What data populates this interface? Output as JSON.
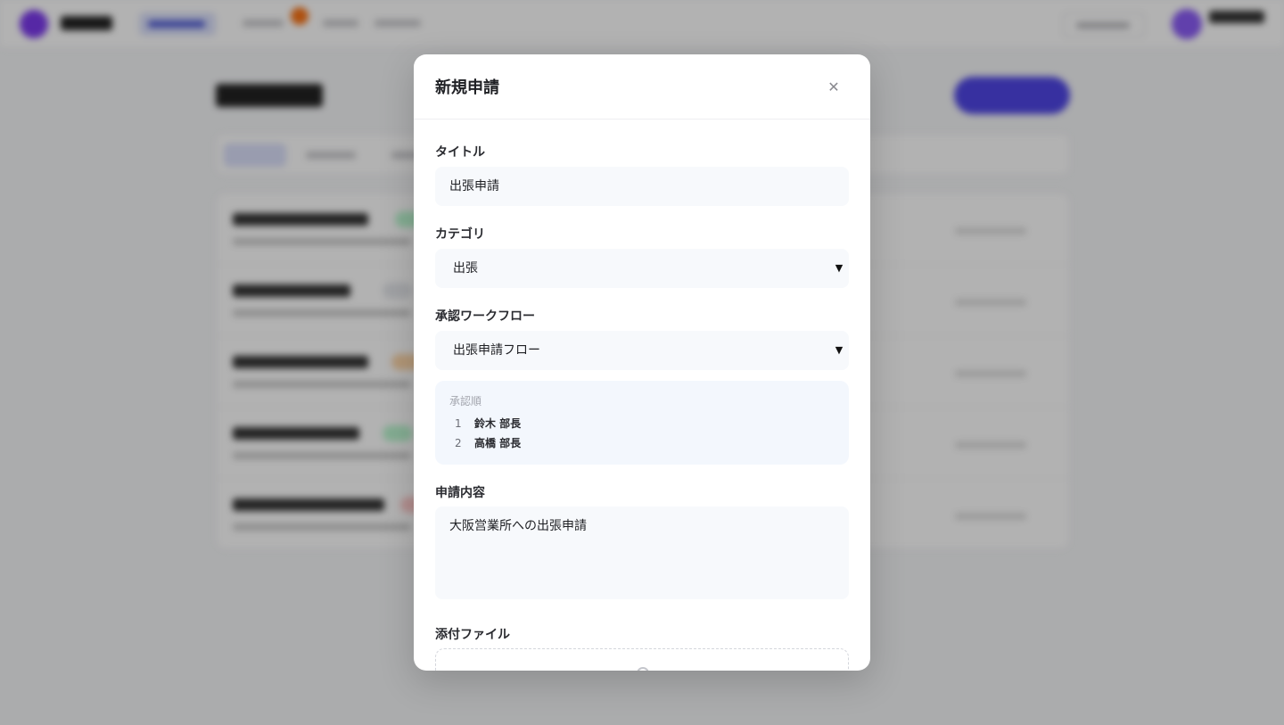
{
  "modal": {
    "title": "新規申請",
    "close_icon": "close-icon",
    "fields": {
      "title_label": "タイトル",
      "title_value": "出張申請",
      "category_label": "カテゴリ",
      "category_value": "出張",
      "workflow_label": "承認ワークフロー",
      "workflow_value": "出張申請フロー",
      "approval_order_title": "承認順",
      "approvers": [
        {
          "order": "1",
          "name": "鈴木 部長"
        },
        {
          "order": "2",
          "name": "高橋 部長"
        }
      ],
      "content_label": "申請内容",
      "content_value": "大阪営業所への出張申請",
      "attachment_label": "添付ファイル",
      "upload_icon": "upload-icon"
    }
  },
  "colors": {
    "accent": "#4f46e5",
    "brand": "#7c3aed",
    "field_bg": "#f7f9fc",
    "approval_bg": "#f3f7fd",
    "overlay": "rgba(0,0,0,0.30)"
  }
}
